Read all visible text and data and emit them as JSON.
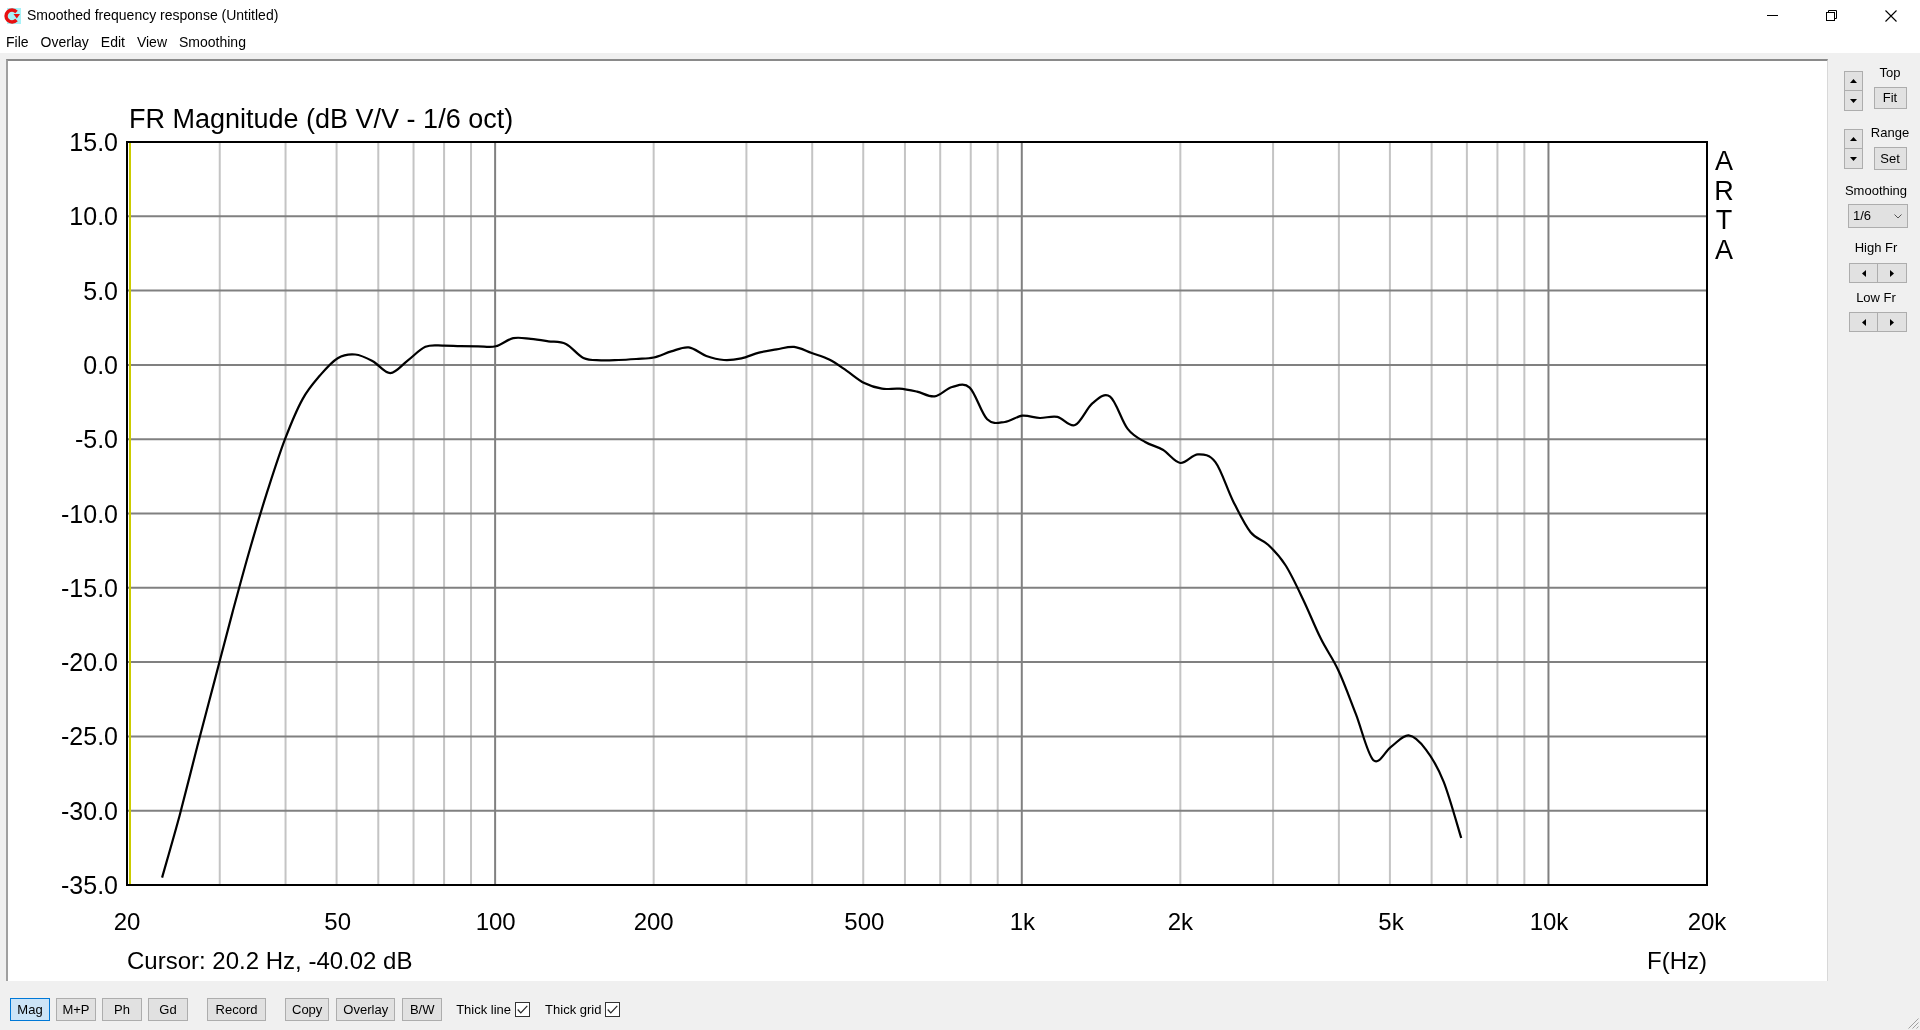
{
  "window": {
    "title": "Smoothed frequency response (Untitled)"
  },
  "menu": [
    "File",
    "Overlay",
    "Edit",
    "View",
    "Smoothing"
  ],
  "plot": {
    "chart_data": {
      "type": "line",
      "title": "FR Magnitude (dB V/V - 1/6 oct)",
      "xlabel": "F(Hz)",
      "grid": true,
      "categories": [
        "20",
        null,
        null,
        null,
        null,
        null,
        null,
        null,
        null,
        null,
        null,
        null,
        "50",
        null,
        null,
        null,
        null,
        null,
        null,
        null,
        null,
        "100",
        null,
        null,
        null,
        null,
        null,
        null,
        null,
        null,
        "200",
        null,
        null,
        null,
        null,
        null,
        null,
        null,
        null,
        null,
        null,
        null,
        "500",
        null,
        null,
        null,
        null,
        null,
        null,
        null,
        null,
        "1k",
        null,
        null,
        null,
        null,
        null,
        null,
        null,
        null,
        "2k",
        null,
        null,
        null,
        null,
        null,
        null,
        null,
        null,
        null,
        null,
        null,
        "5k",
        null,
        null,
        null,
        null,
        null,
        null,
        null,
        null,
        "10k",
        null,
        null,
        null,
        null,
        null,
        null,
        null,
        null,
        "20k"
      ],
      "series": [
        {
          "color": "#000000",
          "values": [
            null,
            null,
            -34.5,
            -30.3,
            -25.7,
            -21.2,
            -16.7,
            -12.4,
            -8.5,
            -5,
            -2.3,
            -0.7,
            0.45,
            0.7,
            0.25,
            -0.55,
            0.3,
            1.22,
            1.3,
            1.26,
            1.25,
            1.25,
            1.8,
            1.75,
            1.59,
            1.41,
            0.47,
            0.31,
            0.33,
            0.4,
            0.5,
            0.91,
            1.18,
            0.6,
            0.33,
            0.44,
            0.83,
            1.04,
            1.21,
            0.8,
            0.36,
            -0.4,
            -1.22,
            -1.6,
            -1.6,
            -1.8,
            -2.12,
            -1.49,
            -1.53,
            -3.66,
            -3.84,
            -3.42,
            -3.57,
            -3.5,
            -4.05,
            -2.57,
            -2.13,
            -4.31,
            -5.19,
            -5.71,
            -6.6,
            -6.02,
            -6.54,
            -9.15,
            -11.26,
            -12.1,
            -13.5,
            -15.8,
            -18.42,
            -20.55,
            -23.5,
            -26.6,
            -25.7,
            -24.93,
            -25.9,
            -28.06,
            -31.84,
            null,
            null,
            null,
            null,
            null,
            null,
            null,
            null,
            null,
            null,
            null,
            null,
            null,
            null
          ]
        }
      ],
      "ylim": [
        -35,
        15
      ],
      "yticks": [
        {
          "value": 15,
          "label": "15.0"
        },
        {
          "value": 10,
          "label": "10.0"
        },
        {
          "value": 5,
          "label": "5.0"
        },
        {
          "value": 0,
          "label": "0.0"
        },
        {
          "value": -5,
          "label": "-5.0"
        },
        {
          "value": -10,
          "label": "-10.0"
        },
        {
          "value": -15,
          "label": "-15.0"
        },
        {
          "value": -20,
          "label": "-20.0"
        },
        {
          "value": -25,
          "label": "-25.0"
        },
        {
          "value": -30,
          "label": "-30.0"
        },
        {
          "value": -35,
          "label": "-35.0"
        }
      ]
    },
    "cursor_readout": "Cursor: 20.2 Hz, -40.02 dB",
    "logo": "ARTA"
  },
  "side_panel": {
    "top": {
      "label": "Top",
      "button": "Fit"
    },
    "range": {
      "label": "Range",
      "button": "Set"
    },
    "smoothing": {
      "label": "Smoothing",
      "value": "1/6"
    },
    "high_fr": {
      "label": "High Fr"
    },
    "low_fr": {
      "label": "Low Fr"
    }
  },
  "toolbar": {
    "views": [
      {
        "label": "Mag",
        "selected": true
      },
      {
        "label": "M+P",
        "selected": false
      },
      {
        "label": "Ph",
        "selected": false
      },
      {
        "label": "Gd",
        "selected": false
      }
    ],
    "record": "Record",
    "actions": [
      "Copy",
      "Overlay",
      "B/W"
    ],
    "options": [
      {
        "label": "Thick line",
        "checked": true
      },
      {
        "label": "Thick grid",
        "checked": true
      }
    ]
  }
}
